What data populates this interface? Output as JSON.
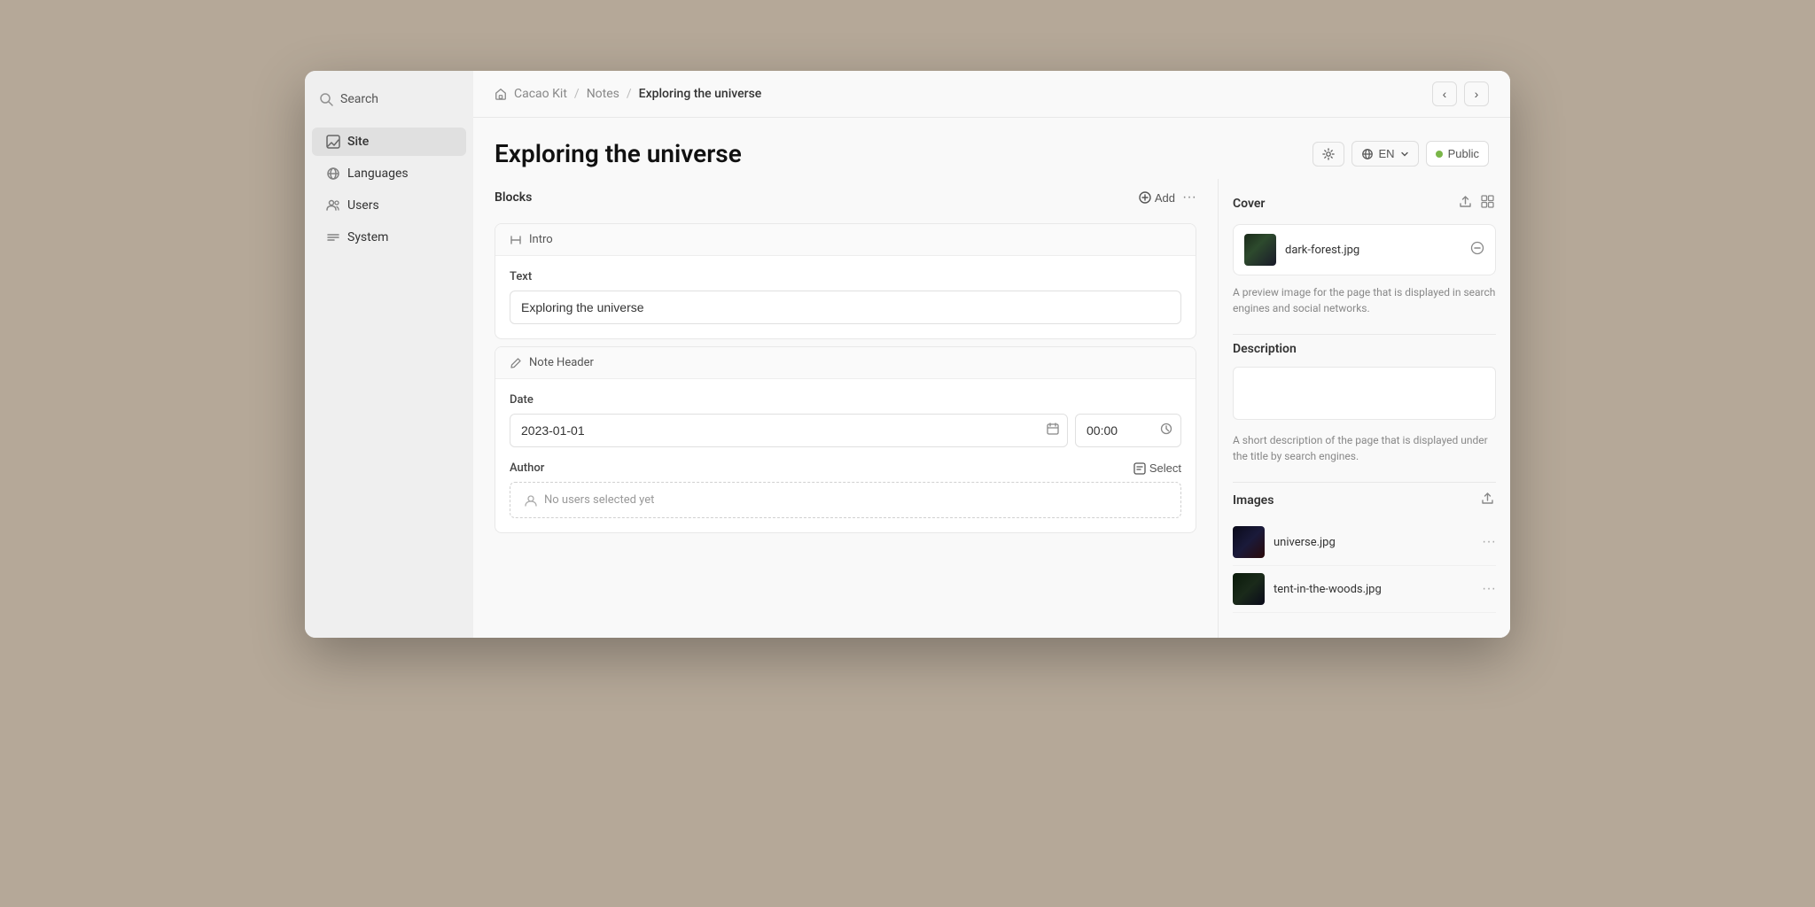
{
  "app": {
    "title": "Cacao Kit",
    "background_color": "#b5a898"
  },
  "breadcrumb": {
    "home": "Cacao Kit",
    "section": "Notes",
    "current": "Exploring the universe",
    "separator": "/"
  },
  "page": {
    "title": "Exploring the universe",
    "language": "EN",
    "status": "Public"
  },
  "sidebar": {
    "search_label": "Search",
    "items": [
      {
        "id": "site",
        "label": "Site",
        "active": true
      },
      {
        "id": "languages",
        "label": "Languages",
        "active": false
      },
      {
        "id": "users",
        "label": "Users",
        "active": false
      },
      {
        "id": "system",
        "label": "System",
        "active": false
      }
    ]
  },
  "blocks": {
    "section_title": "Blocks",
    "add_label": "Add",
    "items": [
      {
        "id": "intro",
        "header_label": "Intro",
        "fields": [
          {
            "label": "Text",
            "type": "input",
            "value": "Exploring the universe",
            "placeholder": ""
          }
        ]
      },
      {
        "id": "note_header",
        "header_label": "Note Header",
        "fields": [
          {
            "label": "Date",
            "type": "date",
            "date_value": "2023-01-01",
            "time_value": "00:00"
          },
          {
            "label": "Author",
            "type": "author",
            "no_users_label": "No users selected yet",
            "select_label": "Select"
          }
        ]
      }
    ]
  },
  "right_panel": {
    "cover": {
      "title": "Cover",
      "filename": "dark-forest.jpg",
      "description": "A preview image for the page that is displayed in search engines and social networks."
    },
    "description": {
      "title": "Description",
      "placeholder": "",
      "help_text": "A short description of the page that is displayed under the title by search engines."
    },
    "images": {
      "title": "Images",
      "items": [
        {
          "filename": "universe.jpg"
        },
        {
          "filename": "tent-in-the-woods.jpg"
        }
      ]
    }
  }
}
